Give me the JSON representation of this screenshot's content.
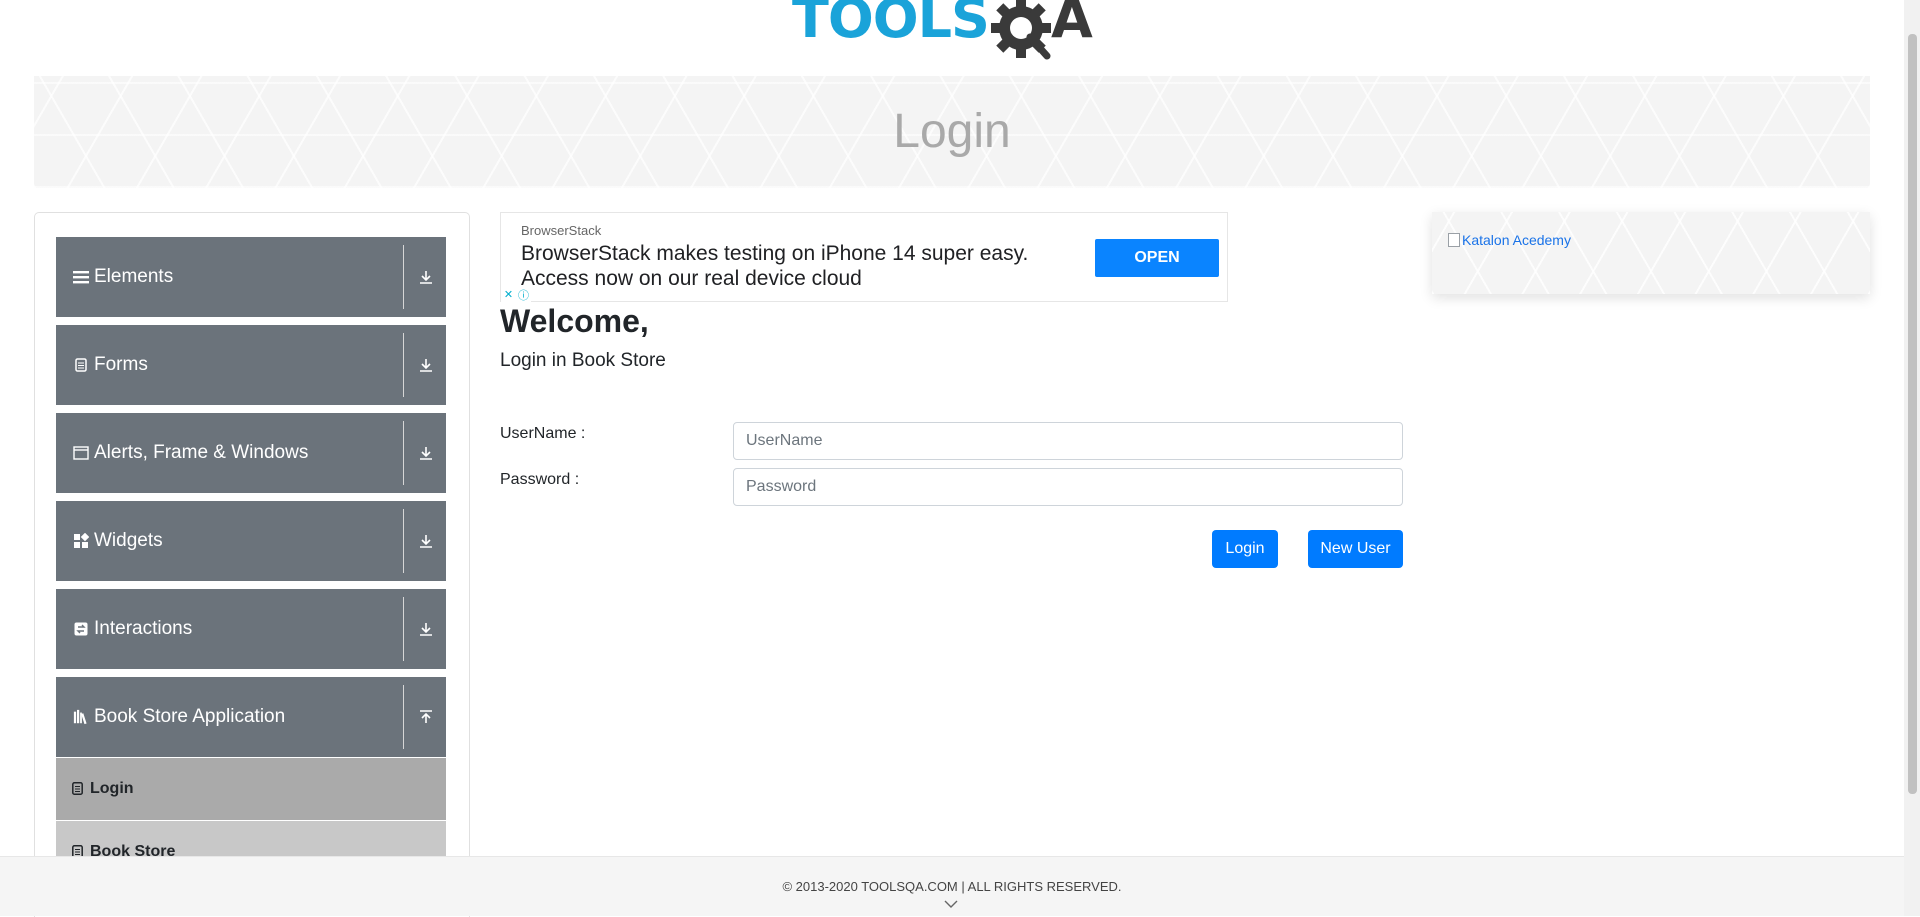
{
  "logo": {
    "tools_text": "TOOLS",
    "qa_text": "A"
  },
  "banner": {
    "title": "Login"
  },
  "sidebar": {
    "groups": [
      {
        "label": "Elements",
        "icon": "hamburger-icon",
        "arrow": "expand-down-icon"
      },
      {
        "label": "Forms",
        "icon": "document-icon",
        "arrow": "expand-down-icon"
      },
      {
        "label": "Alerts, Frame & Windows",
        "icon": "window-icon",
        "arrow": "expand-down-icon"
      },
      {
        "label": "Widgets",
        "icon": "widgets-icon",
        "arrow": "expand-down-icon"
      },
      {
        "label": "Interactions",
        "icon": "swap-icon",
        "arrow": "expand-down-icon"
      },
      {
        "label": "Book Store Application",
        "icon": "books-icon",
        "arrow": "collapse-up-icon"
      }
    ],
    "subitems": [
      {
        "label": "Login",
        "active": true
      },
      {
        "label": "Book Store",
        "active": false
      }
    ]
  },
  "ad": {
    "brand": "BrowserStack",
    "headline": "BrowserStack makes testing on iPhone 14 super easy. Access now on our real device cloud",
    "cta": "OPEN"
  },
  "login": {
    "welcome": "Welcome,",
    "subtitle": "Login in Book Store",
    "username_label": "UserName :",
    "username_placeholder": "UserName",
    "password_label": "Password :",
    "password_placeholder": "Password",
    "login_button": "Login",
    "new_user_button": "New User"
  },
  "right_ad": {
    "alt_text": "Katalon Acedemy"
  },
  "footer": {
    "copyright": "© 2013-2020 TOOLSQA.COM | ALL RIGHTS RESERVED."
  },
  "colors": {
    "sidebar_group_bg": "#6b737b",
    "active_subitem_bg": "#aaaaaa",
    "inactive_subitem_bg": "#c8c8c8",
    "primary_button": "#007bff",
    "ad_button": "#0a84ff",
    "logo_blue": "#1aa3d9"
  }
}
